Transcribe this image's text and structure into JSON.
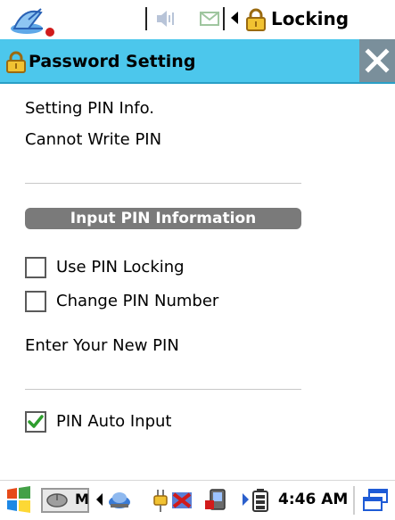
{
  "status_bar": {
    "icons": {
      "system": "satellite-dish-icon",
      "speaker": "speaker-icon",
      "mail": "mail-icon",
      "arrow": "left-arrow-icon",
      "lock": "lock-icon"
    },
    "locking_label": "Locking"
  },
  "title_bar": {
    "title": "Password Setting",
    "icon": "lock-icon",
    "close_icon": "close-icon",
    "color": "#4cc7ec"
  },
  "content": {
    "info_line1": "Setting PIN Info.",
    "info_line2": "Cannot Write PIN",
    "section_header": "Input PIN Information",
    "use_pin_locking": {
      "label": "Use PIN Locking",
      "checked": false
    },
    "change_pin_number": {
      "label": "Change PIN Number",
      "checked": false
    },
    "enter_new_pin": "Enter Your New PIN",
    "pin_auto_input": {
      "label": "PIN Auto Input",
      "checked": true
    }
  },
  "taskbar": {
    "start_icon": "windows-start-icon",
    "window_label": "M",
    "time": "4:46 AM",
    "icons": [
      "network-icon",
      "power-plug-icon",
      "sync-icon",
      "device-icon",
      "battery-icon",
      "desktop-switch-icon"
    ]
  }
}
